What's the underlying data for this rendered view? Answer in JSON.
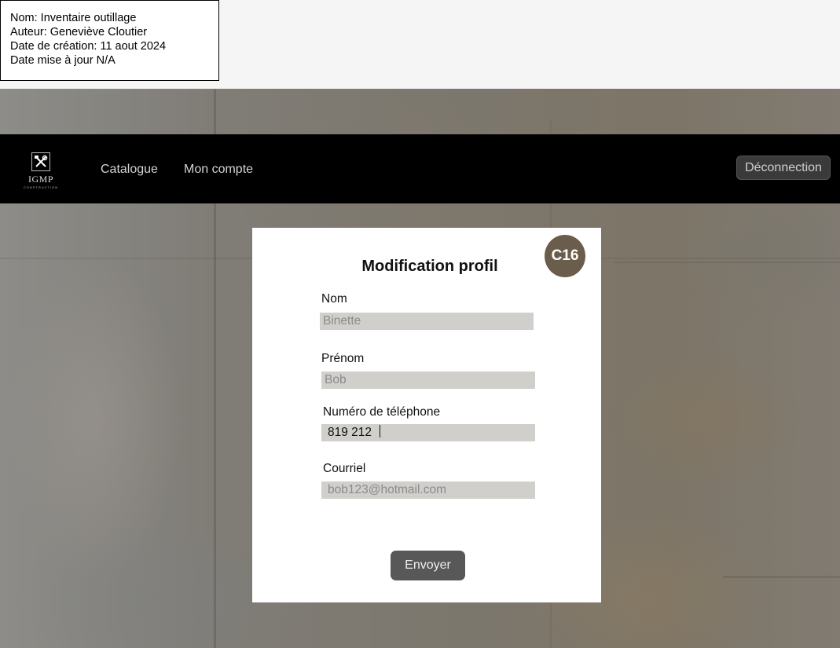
{
  "meta": {
    "name": "Nom: Inventaire outillage",
    "author": "Auteur: Geneviève Cloutier",
    "created": "Date de création: 11 aout 2024",
    "updated": "Date mise à jour N/A"
  },
  "nav": {
    "logo_text": "IGMP",
    "logo_sub": "CONSTRUCTION",
    "links": [
      "Catalogue",
      "Mon compte"
    ],
    "logout": "Déconnection"
  },
  "form": {
    "badge": "C16",
    "title": "Modification profil",
    "fields": [
      {
        "label": "Nom",
        "value": "Binette"
      },
      {
        "label": "Prénom",
        "value": "Bob"
      },
      {
        "label": "Numéro de téléphone",
        "value": "819 212"
      },
      {
        "label": "Courriel",
        "value": "bob123@hotmail.com"
      }
    ],
    "submit": "Envoyer"
  },
  "colors": {
    "navbar": "#000000",
    "badge": "#6b5d4b",
    "input_bg": "#d0cfcc",
    "button": "#585858"
  },
  "icons": {
    "logo": "tools-icon"
  }
}
